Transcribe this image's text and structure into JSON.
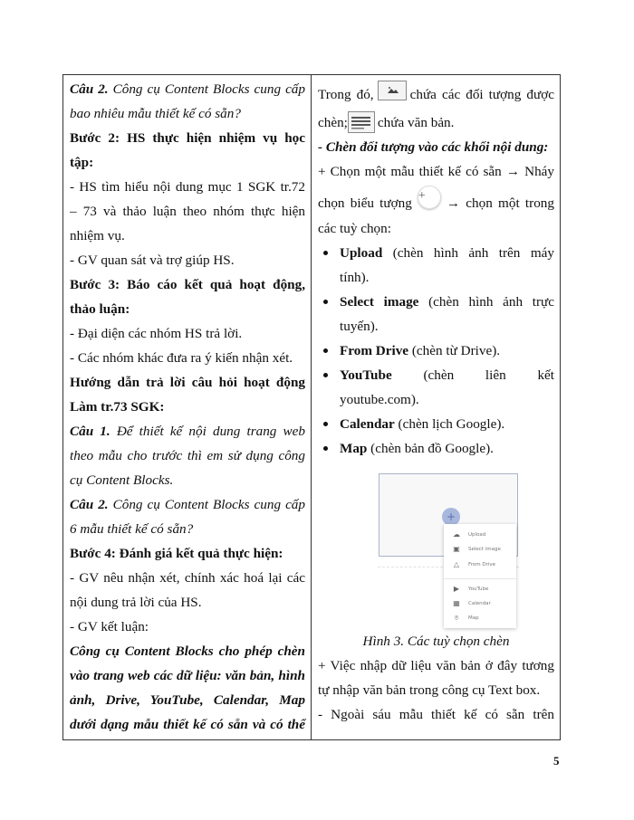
{
  "left_column": {
    "q2_label": "Câu 2.",
    "q2_text_a": " Công cụ Content Blocks cung cấp",
    "q2_text_b": "bao nhiêu mẫu thiết kế có sẵn?",
    "step2_a": "Bước 2: HS thực hiện nhiệm vụ học",
    "step2_b": "tập:",
    "step2_l1": "- HS tìm hiểu nội dung mục 1 SGK tr.72",
    "step2_l2": "– 73 và thảo luận theo nhóm thực hiện",
    "step2_l3": "nhiệm vụ.",
    "step2_l4": "- GV quan sát và trợ giúp HS.",
    "step3_a": "Bước 3: Báo cáo kết quả hoạt động,",
    "step3_b": "thảo luận:",
    "step3_l1": "- Đại diện các nhóm HS trả lời.",
    "step3_l2": "- Các nhóm khác đưa ra ý kiến nhận xét.",
    "guide_a": "Hướng dẫn trả lời câu hỏi hoạt động",
    "guide_b": "Làm tr.73 SGK:",
    "a1_label": "Câu 1.",
    "a1_text_a": " Để thiết kế nội dung trang web",
    "a1_text_b": "theo mẫu cho trước thì em sử dụng công",
    "a1_text_c": "cụ Content Blocks.",
    "a2_label": "Câu 2.",
    "a2_text_a": " Công cụ Content Blocks cung cấp",
    "a2_text_b": "6 mẫu thiết kế có sẵn?",
    "step4": "Bước 4: Đánh giá kết quả thực hiện:",
    "step4_l1": "- GV nêu nhận xét, chính xác hoá lại các",
    "step4_l2": "nội dung trả lời của HS.",
    "step4_l3": "- GV kết luận:",
    "concl_a": "Công cụ Content Blocks cho phép chèn",
    "concl_b": "vào trang web các dữ liệu: văn bản, hình",
    "concl_c": "ảnh, Drive, YouTube, Calendar, Map",
    "concl_d": "dưới dạng mẫu thiết kế có sẵn và có thể"
  },
  "right_column": {
    "intro_a1": "Trong đó,",
    "intro_a2": "chứa các đối tượng được",
    "intro_b1": "chèn;",
    "intro_b2": "chứa văn bản.",
    "insert_heading": "- Chèn đối tượng vào các khối nội dung:",
    "choose_a": "+ Chọn một mẫu thiết kế có sẵn → Nháy",
    "choose_b1": "chọn biểu tượng",
    "choose_b2": "→ chọn một trong",
    "choose_c": "các tuỳ chọn:",
    "plus_glyph": "+",
    "options": [
      {
        "name": "Upload",
        "desc_a": " (chèn hình ảnh trên máy",
        "desc_b": "tính)."
      },
      {
        "name": "Select image",
        "desc_a": " (chèn hình ảnh trực",
        "desc_b": "tuyến)."
      },
      {
        "name": "From Drive",
        "desc_a": " (chèn từ Drive).",
        "desc_b": ""
      },
      {
        "name": "YouTube",
        "desc_a": " (chèn liên kết",
        "desc_b": "youtube.com)."
      },
      {
        "name": "Calendar",
        "desc_a": " (chèn lịch Google).",
        "desc_b": ""
      },
      {
        "name": "Map",
        "desc_a": " (chèn bản đồ Google).",
        "desc_b": ""
      }
    ],
    "figure": {
      "plus_glyph": "+",
      "menu": [
        {
          "icon": "cloud-upload-icon",
          "glyph": "☁",
          "label": "Upload"
        },
        {
          "icon": "image-icon",
          "glyph": "▣",
          "label": "Select image"
        },
        {
          "icon": "drive-icon",
          "glyph": "△",
          "label": "From Drive"
        },
        {
          "icon": "youtube-icon",
          "glyph": "▶",
          "label": "YouTube"
        },
        {
          "icon": "calendar-icon",
          "glyph": "▦",
          "label": "Calendar"
        },
        {
          "icon": "map-pin-icon",
          "glyph": "⌾",
          "label": "Map"
        }
      ],
      "caption": "Hình 3. Các tuỳ chọn chèn"
    },
    "text_a": "+ Việc nhập dữ liệu văn bản ở đây tương",
    "text_b": "tự nhập văn bản trong công cụ Text box.",
    "other_a": "- Ngoài sáu mẫu thiết kế có sẵn trên"
  },
  "page_number": "5"
}
